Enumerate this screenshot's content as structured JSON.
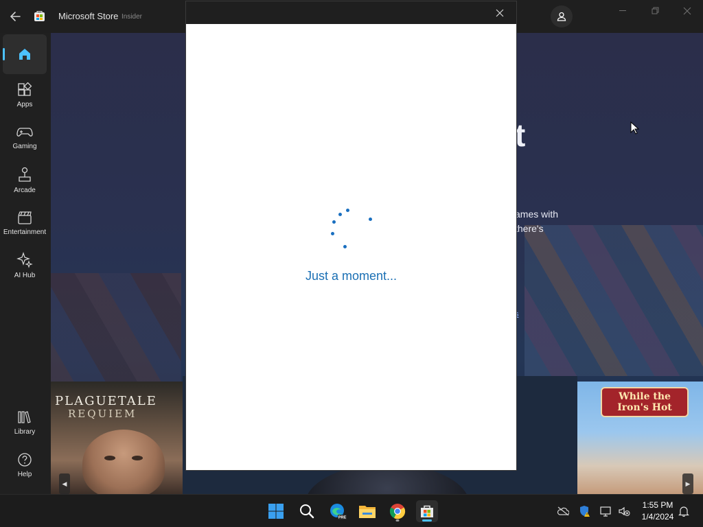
{
  "app": {
    "title": "Microsoft Store",
    "badge": "Insider"
  },
  "sidebar": {
    "items": [
      {
        "label": "",
        "icon": "home-icon",
        "active": true
      },
      {
        "label": "Apps",
        "icon": "apps-icon"
      },
      {
        "label": "Gaming",
        "icon": "gamepad-icon"
      },
      {
        "label": "Arcade",
        "icon": "joystick-icon"
      },
      {
        "label": "Entertainment",
        "icon": "clapperboard-icon"
      },
      {
        "label": "AI Hub",
        "icon": "sparkle-icon"
      }
    ],
    "bottom_items": [
      {
        "label": "Library",
        "icon": "library-icon"
      },
      {
        "label": "Help",
        "icon": "help-icon"
      }
    ]
  },
  "hero": {
    "partial_letter": "t",
    "text_line1": "ames with",
    "text_line2": "there's",
    "partial_link": "s"
  },
  "tiles": {
    "left_title_line1": "PLAGUETALE",
    "left_title_line2": "REQUIEM",
    "right_title": "While the Iron's Hot"
  },
  "dialog": {
    "loading_text": "Just a moment..."
  },
  "taskbar": {
    "apps": [
      "start-icon",
      "search-icon",
      "edge-preview-icon",
      "file-explorer-icon",
      "chrome-icon",
      "microsoft-store-icon"
    ],
    "time": "1:55 PM",
    "date": "1/4/2024"
  },
  "colors": {
    "accent": "#4cc2ff",
    "loading": "#1a6fb4",
    "titlebar": "#1f1f1f"
  }
}
